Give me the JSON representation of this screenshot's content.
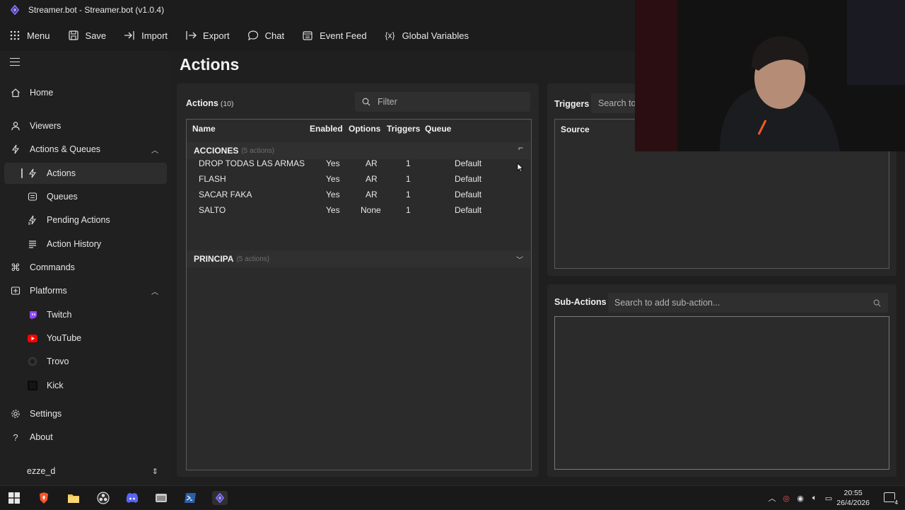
{
  "window": {
    "title": "Streamer.bot - Streamer.bot (v1.0.4)"
  },
  "toolbar": {
    "menu": "Menu",
    "save": "Save",
    "import": "Import",
    "export": "Export",
    "chat": "Chat",
    "event_feed": "Event Feed",
    "global_variables": "Global Variables"
  },
  "sidebar": {
    "home": "Home",
    "viewers": "Viewers",
    "actions_queues": "Actions & Queues",
    "actions": "Actions",
    "queues": "Queues",
    "pending_actions": "Pending Actions",
    "action_history": "Action History",
    "commands": "Commands",
    "platforms": "Platforms",
    "twitch": "Twitch",
    "youtube": "YouTube",
    "trovo": "Trovo",
    "kick": "Kick",
    "settings": "Settings",
    "about": "About",
    "user": "ezze_d"
  },
  "page": {
    "title": "Actions"
  },
  "actions_panel": {
    "label": "Actions",
    "count": "(10)",
    "filter_placeholder": "Filter",
    "columns": {
      "name": "Name",
      "enabled": "Enabled",
      "options": "Options",
      "triggers": "Triggers",
      "queue": "Queue"
    },
    "groups": [
      {
        "name": "ACCIONES",
        "count": "(5 actions)",
        "rows": [
          {
            "name": "DROP TODAS LAS ARMAS",
            "enabled": "Yes",
            "options": "AR",
            "triggers": "1",
            "queue": "Default"
          },
          {
            "name": "FLASH",
            "enabled": "Yes",
            "options": "AR",
            "triggers": "1",
            "queue": "Default"
          },
          {
            "name": "SACAR FAKA",
            "enabled": "Yes",
            "options": "AR",
            "triggers": "1",
            "queue": "Default"
          },
          {
            "name": "SALTO",
            "enabled": "Yes",
            "options": "None",
            "triggers": "1",
            "queue": "Default"
          }
        ]
      },
      {
        "name": "PRINCIPA",
        "count": "(5 actions)"
      }
    ]
  },
  "triggers_panel": {
    "label": "Triggers",
    "search_placeholder": "Search to",
    "column_source": "Source"
  },
  "subactions_panel": {
    "label": "Sub-Actions",
    "search_placeholder": "Search to add sub-action..."
  },
  "taskbar": {
    "time": "20:55",
    "date": "26/4/2026",
    "notifications": "4"
  },
  "colors": {
    "accent": "#7b6cff",
    "bg": "#1f1f1f",
    "panel": "#272727"
  }
}
